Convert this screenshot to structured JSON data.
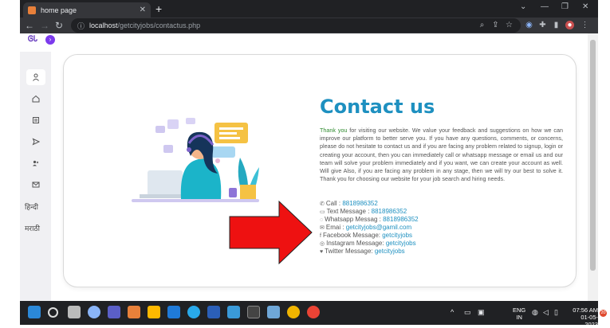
{
  "browser": {
    "tab_title": "home page",
    "tab_close": "✕",
    "new_tab": "+",
    "url_host": "localhost",
    "url_path": "/getcityjobs/contactus.php"
  },
  "sidebar": {
    "items": [
      {
        "icon": "user-icon"
      },
      {
        "icon": "home-icon"
      },
      {
        "icon": "document-icon"
      },
      {
        "icon": "send-icon"
      },
      {
        "icon": "users-icon"
      },
      {
        "icon": "mail-icon"
      }
    ],
    "lang_hindi": "हिन्दी",
    "lang_marathi": "मराठी"
  },
  "content": {
    "heading": "Contact us",
    "thank_you": "Thank you",
    "paragraph": " for visiting our website. We value your feedback and suggestions on how we can improve our platform to better serve you. If you have any questions, comments, or concerns, please do not hesitate to contact us and if you are facing any problem related to signup, login or creating your account, then you can immediately call or whatsapp message or email us and our team will solve your problem immediately and if you want, we can create your account as well. Will give Also, if you are facing any problem in any stage, then we will try our best to solve it. Thank you for choosing our website for your job search and hiring needs.",
    "contacts": [
      {
        "label": "Call : ",
        "value": "8818986352",
        "icon": "phone-icon"
      },
      {
        "label": "Text Message : ",
        "value": "8818986352",
        "icon": "message-icon"
      },
      {
        "label": "Whatsapp Messag : ",
        "value": "8818986352",
        "icon": "whatsapp-icon"
      },
      {
        "label": "Emai : ",
        "value": "getcityjobs@gamil.com",
        "icon": "mail-icon"
      },
      {
        "label": "Facebook Message: ",
        "value": "getcityjobs",
        "icon": "facebook-icon"
      },
      {
        "label": "Instagram Message: ",
        "value": "getcityjobs",
        "icon": "instagram-icon"
      },
      {
        "label": "Twitter Message: ",
        "value": "getcityjobs",
        "icon": "twitter-icon"
      }
    ]
  },
  "taskbar": {
    "lang_top": "ENG",
    "lang_bottom": "IN",
    "time": "07:56 AM",
    "date": "01-05-2023",
    "notif_count": "20"
  },
  "colors": {
    "accent": "#1e90c0",
    "arrow_fill": "#ee1111"
  }
}
